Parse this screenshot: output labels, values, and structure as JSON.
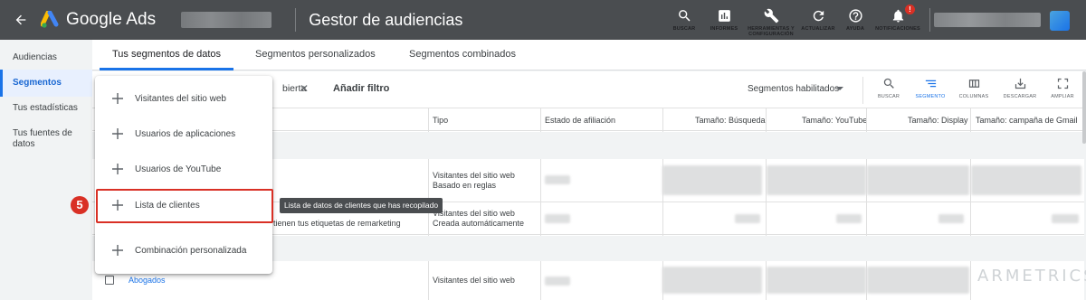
{
  "topbar": {
    "app_name": "Google Ads",
    "page_title": "Gestor de audiencias",
    "notification_count": "!",
    "tools": [
      {
        "label": "BUSCAR",
        "icon": "search-icon"
      },
      {
        "label": "INFORMES",
        "icon": "reports-icon"
      },
      {
        "label": "HERRAMIENTAS Y CONFIGURACIÓN",
        "icon": "wrench-icon"
      },
      {
        "label": "ACTUALIZAR",
        "icon": "refresh-icon"
      },
      {
        "label": "AYUDA",
        "icon": "help-icon"
      },
      {
        "label": "NOTIFICACIONES",
        "icon": "bell-icon"
      }
    ]
  },
  "sidenav": {
    "items": [
      {
        "label": "Audiencias"
      },
      {
        "label": "Segmentos"
      },
      {
        "label": "Tus estadísticas"
      },
      {
        "label": "Tus fuentes de datos"
      }
    ]
  },
  "tabs": [
    {
      "label": "Tus segmentos de datos"
    },
    {
      "label": "Segmentos personalizados"
    },
    {
      "label": "Segmentos combinados"
    }
  ],
  "filterbar": {
    "chip_text": "bierta",
    "add_filter": "Añadir filtro",
    "segment_select": "Segmentos habilitados",
    "view_tools": [
      {
        "label": "BUSCAR",
        "icon": "search-icon"
      },
      {
        "label": "SEGMENTO",
        "icon": "segment-icon"
      },
      {
        "label": "COLUMNAS",
        "icon": "columns-icon"
      },
      {
        "label": "DESCARGAR",
        "icon": "download-icon"
      },
      {
        "label": "AMPLIAR",
        "icon": "expand-icon"
      }
    ]
  },
  "table": {
    "headers": [
      "Tipo",
      "Estado de afiliación",
      "Tamaño: Búsqueda",
      "Tamaño: YouTube",
      "Tamaño: Display",
      "Tamaño: campaña de Gmail"
    ],
    "rows": [
      {
        "tipo_1": "Visitantes del sitio web",
        "tipo_2": "Basado en reglas"
      },
      {
        "tipo_1": "Visitantes del sitio web",
        "tipo_2": "Creada automáticamente",
        "name_fragment": "tienen tus etiquetas de remarketing"
      },
      {
        "name": "Abogados",
        "tipo_1": "Visitantes del sitio web"
      }
    ]
  },
  "menu": {
    "items": [
      {
        "label": "Visitantes del sitio web"
      },
      {
        "label": "Usuarios de aplicaciones"
      },
      {
        "label": "Usuarios de YouTube"
      },
      {
        "label": "Lista de clientes"
      },
      {
        "label": "Combinación personalizada"
      }
    ]
  },
  "annotation": {
    "step_number": "5",
    "tooltip": "Lista de datos de clientes que has recopilado"
  },
  "watermark": "ARMETRICS",
  "colors": {
    "topbar": "#4a4d50",
    "accent": "#1a73e8",
    "highlight": "#d93025"
  }
}
